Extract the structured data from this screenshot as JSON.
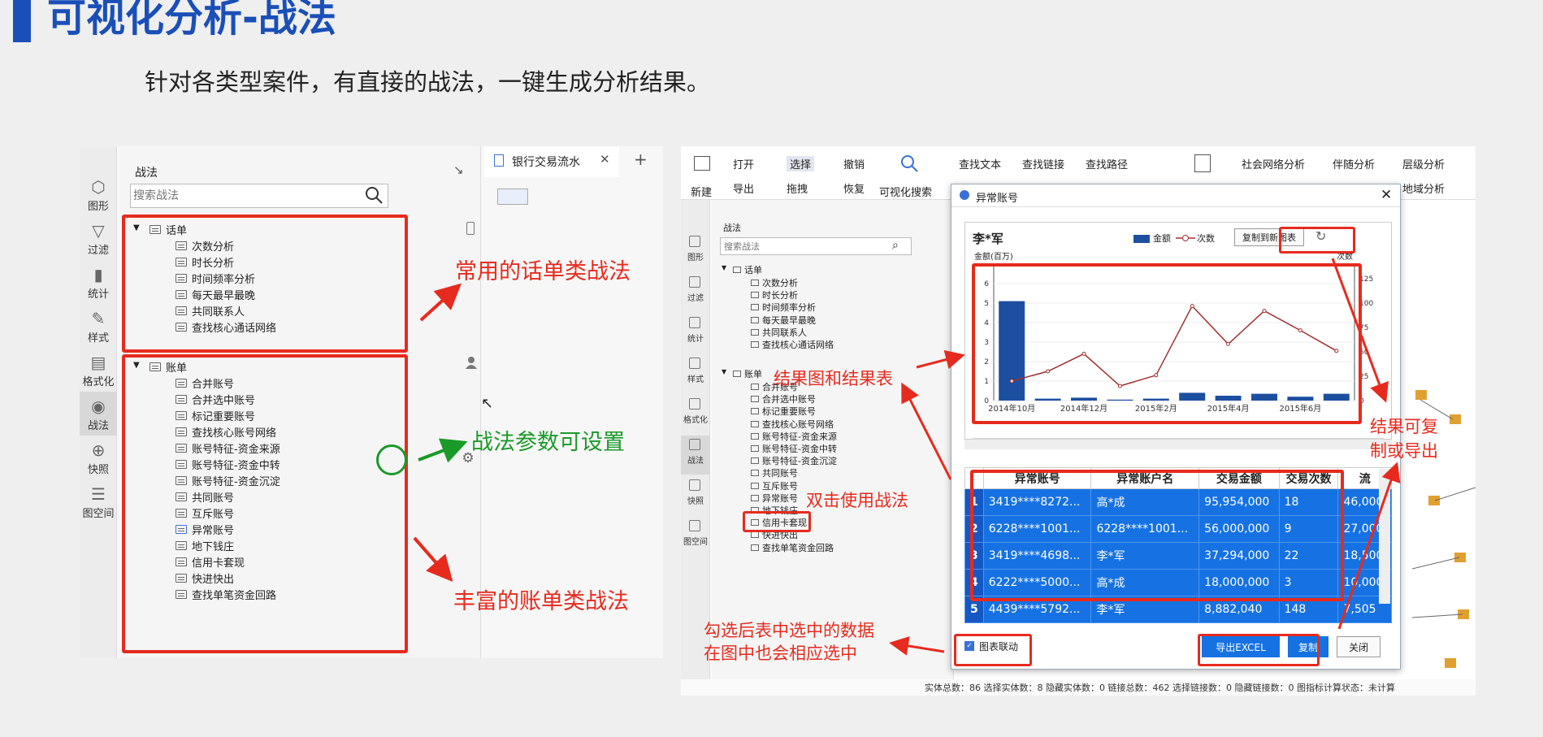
{
  "slide": {
    "title": "可视化分析-战法",
    "subtitle": "针对各类型案件，有直接的战法，一键生成分析结果。"
  },
  "left": {
    "sidebar": [
      {
        "label": "图形",
        "icon": "shapes-icon"
      },
      {
        "label": "过滤",
        "icon": "filter-icon"
      },
      {
        "label": "统计",
        "icon": "bar-chart-icon"
      },
      {
        "label": "样式",
        "icon": "edit-icon"
      },
      {
        "label": "格式化",
        "icon": "format-icon"
      },
      {
        "label": "战法",
        "icon": "tactic-icon"
      },
      {
        "label": "快照",
        "icon": "snapshot-icon"
      },
      {
        "label": "图空间",
        "icon": "database-icon"
      }
    ],
    "panel_title": "战法",
    "search_placeholder": "搜索战法",
    "tab_label": "银行交易流水",
    "group1": "话单",
    "group1_items": [
      "次数分析",
      "时长分析",
      "时间频率分析",
      "每天最早最晚",
      "共同联系人",
      "查找核心通话网络"
    ],
    "group2": "账单",
    "group2_items": [
      "合并账号",
      "合并选中账号",
      "标记重要账号",
      "查找核心账号网络",
      "账号特征-资金来源",
      "账号特征-资金中转",
      "账号特征-资金沉淀",
      "共同账号",
      "互斥账号",
      "异常账号",
      "地下钱庄",
      "信用卡套现",
      "快进快出",
      "查找单笔资金回路"
    ]
  },
  "annotations": {
    "common_call": "常用的话单类战法",
    "params": "战法参数可设置",
    "rich_bill": "丰富的账单类战法",
    "result": "结果图和结果表",
    "dblclick": "双击使用战法",
    "copy_export": "结果可复\n制或导出",
    "linkage_line1": "勾选后表中选中的数据",
    "linkage_line2": "在图中也会相应选中"
  },
  "right": {
    "toolbar": {
      "new": "新建",
      "open": "打开",
      "export": "导出",
      "select": "选择",
      "drag": "拖拽",
      "undo": "撤销",
      "redo": "恢复",
      "vis_search": "可视化搜索",
      "find_text": "查找文本",
      "find_link": "查找链接",
      "find_path": "查找路径",
      "social": "社会网络分析",
      "companion": "伴随分析",
      "hierarchy": "层级分析",
      "geo": "地域分析"
    },
    "panel_title": "战法",
    "search_placeholder": "搜索战法",
    "group1": "话单",
    "group1_items": [
      "次数分析",
      "时长分析",
      "时间频率分析",
      "每天最早最晚",
      "共同联系人",
      "查找核心通话网络"
    ],
    "group2": "账单",
    "group2_items": [
      "合并账号",
      "合并选中账号",
      "标记重要账号",
      "查找核心账号网络",
      "账号特征-资金来源",
      "账号特征-资金中转",
      "账号特征-资金沉淀",
      "共同账号",
      "互斥账号",
      "异常账号",
      "地下钱庄",
      "信用卡套现",
      "快进快出",
      "查找单笔资金回路"
    ],
    "sidebar": [
      "图形",
      "过滤",
      "统计",
      "样式",
      "格式化",
      "战法",
      "快照",
      "图空间"
    ],
    "status_bar": "实体总数：86 选择实体数：8 隐藏实体数：0 链接总数：462 选择链接数：0 隐藏链接数：0 图指标计算状态：未计算"
  },
  "dialog": {
    "title": "异常账号",
    "chart_person": "李*军",
    "copy_new_chart": "复制到新图表",
    "columns": [
      "异常账号",
      "异常账户名",
      "交易金额",
      "交易次数",
      "流"
    ],
    "rows": [
      [
        "1",
        "3419****8272...",
        "高*成",
        "95,954,000",
        "18",
        "46,000"
      ],
      [
        "2",
        "6228****1001...",
        "6228****1001...",
        "56,000,000",
        "9",
        "27,000"
      ],
      [
        "3",
        "3419****4698...",
        "李*军",
        "37,294,000",
        "22",
        "18,500"
      ],
      [
        "4",
        "6222****5000...",
        "高*成",
        "18,000,000",
        "3",
        "10,000"
      ],
      [
        "5",
        "4439****5792...",
        "李*军",
        "8,882,040",
        "148",
        "7,505"
      ]
    ],
    "linkage_label": "图表联动",
    "export_excel": "导出EXCEL",
    "copy": "复制",
    "close": "关闭"
  },
  "chart_data": {
    "type": "bar",
    "title": "",
    "ylabel": "金额(百万)",
    "y2label": "次数",
    "categories": [
      "2014年10月",
      "2014年11月",
      "2014年12月",
      "2015年1月",
      "2015年2月",
      "2015年3月",
      "2015年4月",
      "2015年5月",
      "2015年6月",
      "2015年7月"
    ],
    "tick_labels": [
      "2014年10月",
      "2014年12月",
      "2015年2月",
      "2015年4月",
      "2015年6月"
    ],
    "series": [
      {
        "name": "金额",
        "kind": "bar",
        "color": "#1c4fa0",
        "values": [
          5.1,
          0.1,
          0.15,
          0.05,
          0.1,
          0.4,
          0.25,
          0.35,
          0.2,
          0.35
        ]
      },
      {
        "name": "次数",
        "kind": "line",
        "color": "#a03030",
        "values": [
          20,
          30,
          48,
          15,
          26,
          97,
          58,
          92,
          72,
          51
        ]
      }
    ],
    "ylim": [
      0,
      7
    ],
    "yticks": [
      0,
      1,
      2,
      3,
      4,
      5,
      6
    ],
    "y2lim": [
      0,
      140
    ],
    "y2ticks": [
      0,
      25,
      50,
      75,
      100,
      125
    ],
    "legend": "top"
  }
}
